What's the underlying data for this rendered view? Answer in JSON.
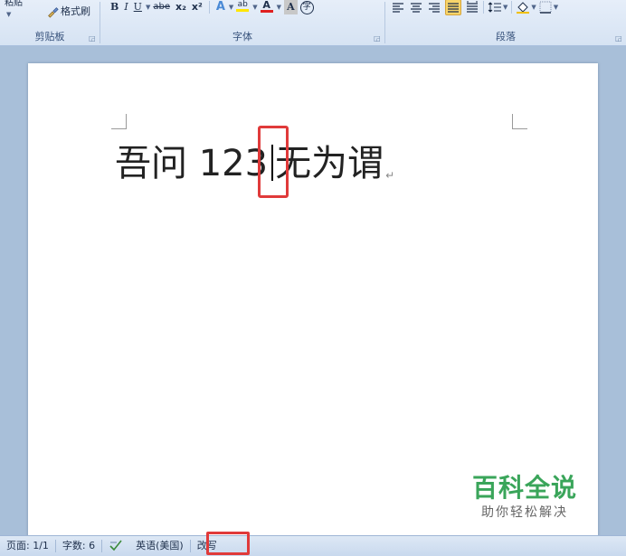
{
  "ribbon": {
    "clipboard": {
      "paste_label_fragment": "粘贴",
      "format_painter_label": "格式刷",
      "group_label": "剪贴板"
    },
    "font": {
      "bold": "B",
      "italic": "I",
      "underline": "U",
      "strikethrough": "abe",
      "subscript": "x₂",
      "superscript": "x²",
      "text_effects": "A",
      "highlight": "ab",
      "font_color": "A",
      "char_shading": "A",
      "enclose": "字",
      "group_label": "字体"
    },
    "paragraph": {
      "group_label": "段落"
    }
  },
  "document": {
    "text_before_cursor": "吾问 123",
    "text_after_cursor": "无为谓",
    "paragraph_mark": "↵"
  },
  "watermark": {
    "title": "百科全说",
    "subtitle": "助你轻松解决"
  },
  "status_bar": {
    "page": "页面: 1/1",
    "word_count": "字数: 6",
    "language": "英语(美国)",
    "overtype_mode": "改写"
  },
  "colors": {
    "highlight_box": "#e03a3a",
    "watermark_green": "#3aa55a",
    "ribbon_bg": "#dfe9f6"
  }
}
